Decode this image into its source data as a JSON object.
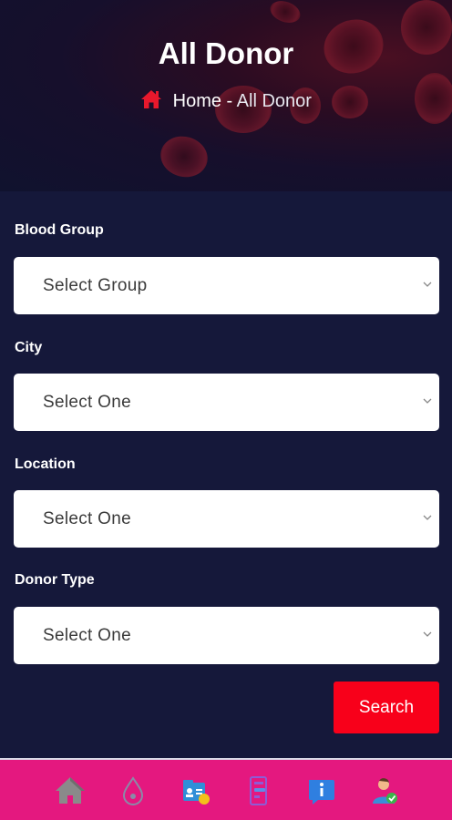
{
  "header": {
    "title": "All Donor",
    "breadcrumb_home": "Home",
    "breadcrumb_separator": "-",
    "breadcrumb_current": "All Donor"
  },
  "form": {
    "blood_group": {
      "label": "Blood Group",
      "value": "Select Group"
    },
    "city": {
      "label": "City",
      "value": "Select One"
    },
    "location": {
      "label": "Location",
      "value": "Select One"
    },
    "donor_type": {
      "label": "Donor Type",
      "value": "Select One"
    },
    "search_label": "Search"
  },
  "bottom_nav": {
    "items": [
      {
        "icon": "home-icon"
      },
      {
        "icon": "blood-drop-icon"
      },
      {
        "icon": "donor-card-icon"
      },
      {
        "icon": "request-list-icon"
      },
      {
        "icon": "info-icon"
      },
      {
        "icon": "profile-icon"
      }
    ]
  },
  "colors": {
    "background": "#15183a",
    "accent_red": "#f8001a",
    "nav_bar": "#e4187f",
    "home_icon_red": "#e8182c"
  }
}
